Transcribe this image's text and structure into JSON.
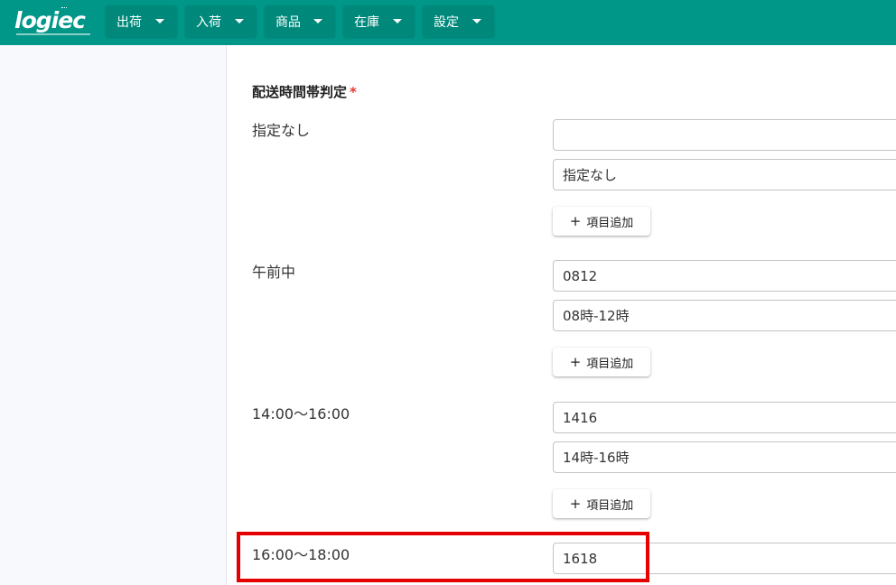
{
  "brand": {
    "logo_text": "logiec"
  },
  "menu": [
    {
      "label": "出荷"
    },
    {
      "label": "入荷"
    },
    {
      "label": "商品"
    },
    {
      "label": "在庫"
    },
    {
      "label": "設定"
    }
  ],
  "section": {
    "title": "配送時間帯判定",
    "required_mark": "*"
  },
  "add_button_label": "項目追加",
  "rows": [
    {
      "label": "指定なし",
      "code": "",
      "display": "指定なし"
    },
    {
      "label": "午前中",
      "code": "0812",
      "display": "08時-12時"
    },
    {
      "label": "14:00〜16:00",
      "code": "1416",
      "display": "14時-16時"
    },
    {
      "label": "16:00〜18:00",
      "code": "1618"
    }
  ],
  "colors": {
    "header": "#009688",
    "menu_button": "#00897b",
    "highlight": "#e50000",
    "required": "#e53935"
  }
}
